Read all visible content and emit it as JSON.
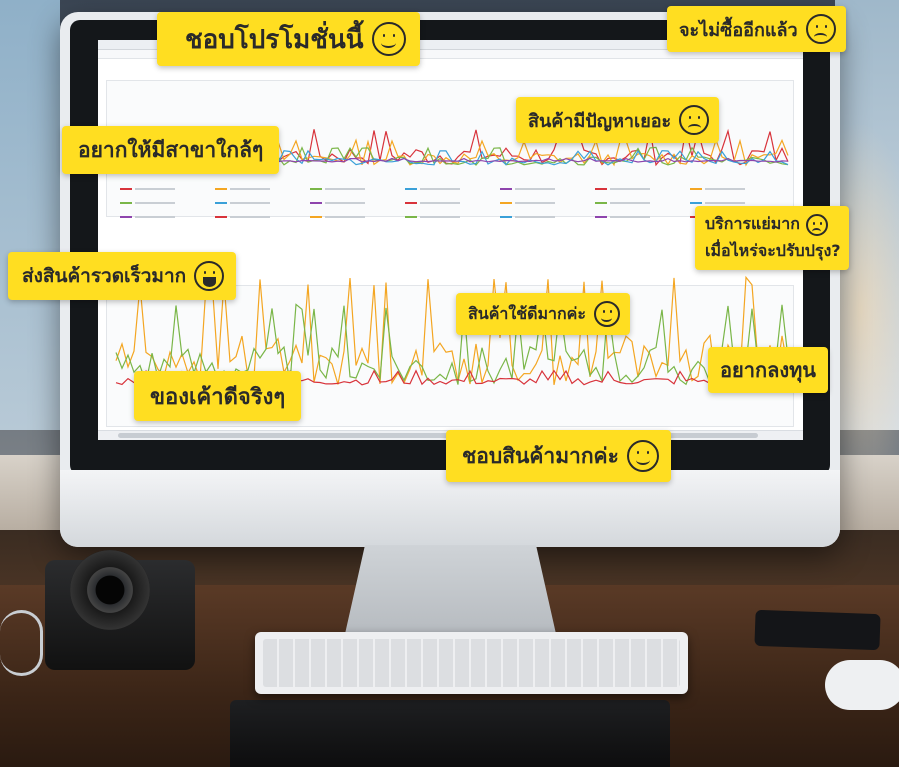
{
  "bubbles": {
    "b1": "ชอบโปรโมชั่นนี้",
    "b2": "จะไม่ซื้ออีกแล้ว",
    "b3": "สินค้ามีปัญหาเยอะ",
    "b4": "อยากให้มีสาขาใกล้ๆ",
    "b5_line1": "บริการแย่มาก",
    "b5_line2": "เมื่อไหร่จะปรับปรุง?",
    "b6": "ส่งสินค้ารวดเร็วมาก",
    "b7": "สินค้าใช้ดีมากค่ะ",
    "b8": "อยากลงทุน",
    "b9": "ของเค้าดีจริงๆ",
    "b10": "ชอบสินค้ามากค่ะ"
  },
  "icons": {
    "smile": "smile-face-icon",
    "sad": "sad-face-icon",
    "laugh": "laughing-face-icon"
  },
  "colors": {
    "bubble": "#ffde21",
    "bubble_text": "#2a2a2a",
    "series_red": "#d8333b",
    "series_orange": "#f4a622",
    "series_green": "#7ab648",
    "series_blue": "#3aa0d8",
    "series_purple": "#8e44ad"
  }
}
